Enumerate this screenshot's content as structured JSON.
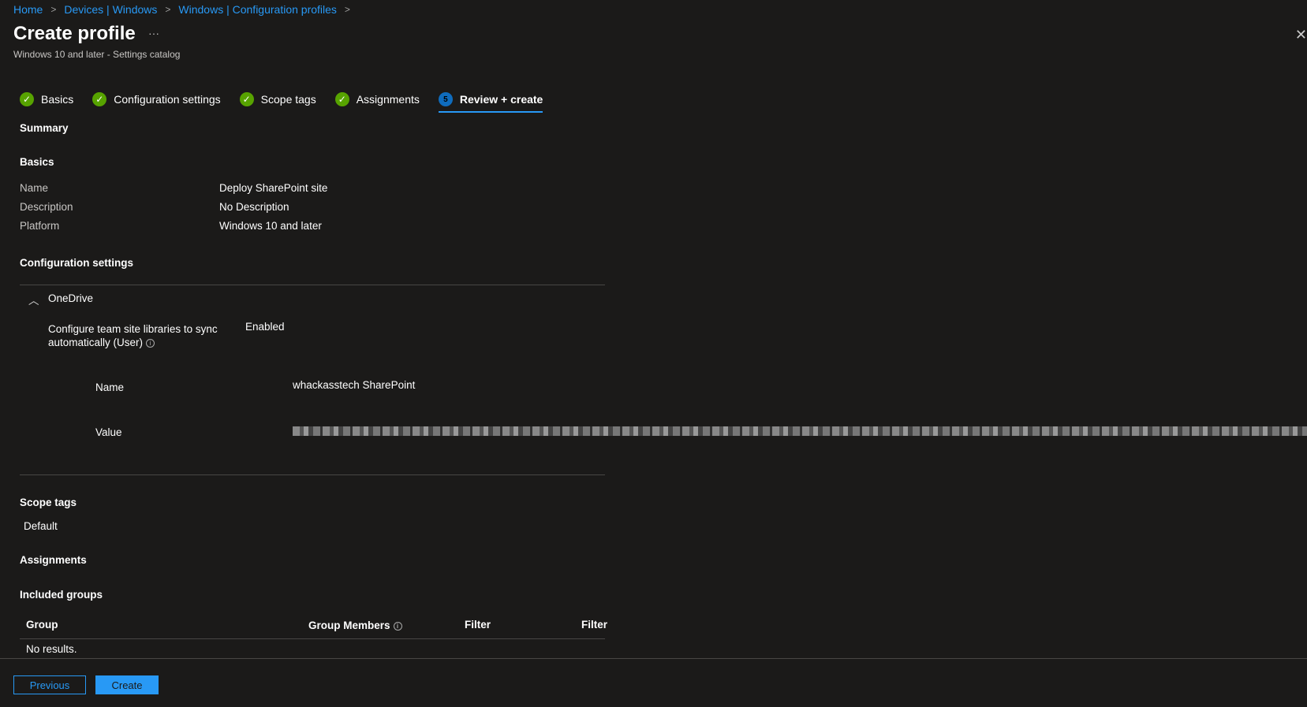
{
  "breadcrumb": [
    "Home",
    "Devices | Windows",
    "Windows | Configuration profiles"
  ],
  "header": {
    "title": "Create profile",
    "more": "···",
    "subtitle": "Windows 10 and later - Settings catalog",
    "close": "✕"
  },
  "tabs": [
    {
      "label": "Basics",
      "state": "done"
    },
    {
      "label": "Configuration settings",
      "state": "done"
    },
    {
      "label": "Scope tags",
      "state": "done"
    },
    {
      "label": "Assignments",
      "state": "done"
    },
    {
      "label": "Review + create",
      "state": "active",
      "number": "5"
    }
  ],
  "summary": "Summary",
  "basics": {
    "heading": "Basics",
    "rows": [
      {
        "label": "Name",
        "value": "Deploy SharePoint site"
      },
      {
        "label": "Description",
        "value": "No Description"
      },
      {
        "label": "Platform",
        "value": "Windows 10 and later"
      }
    ]
  },
  "config": {
    "heading": "Configuration settings",
    "group": "OneDrive",
    "setting_line1": "Configure team site libraries to sync",
    "setting_line2": "automatically (User)",
    "setting_value": "Enabled",
    "name_label": "Name",
    "name_value": "whackasstech SharePoint",
    "value_label": "Value"
  },
  "scope": {
    "heading": "Scope tags",
    "value": "Default"
  },
  "assignments": {
    "heading": "Assignments",
    "included": "Included groups",
    "columns": [
      "Group",
      "Group Members",
      "Filter",
      "Filter"
    ],
    "empty": "No results."
  },
  "footer": {
    "previous": "Previous",
    "create": "Create"
  }
}
